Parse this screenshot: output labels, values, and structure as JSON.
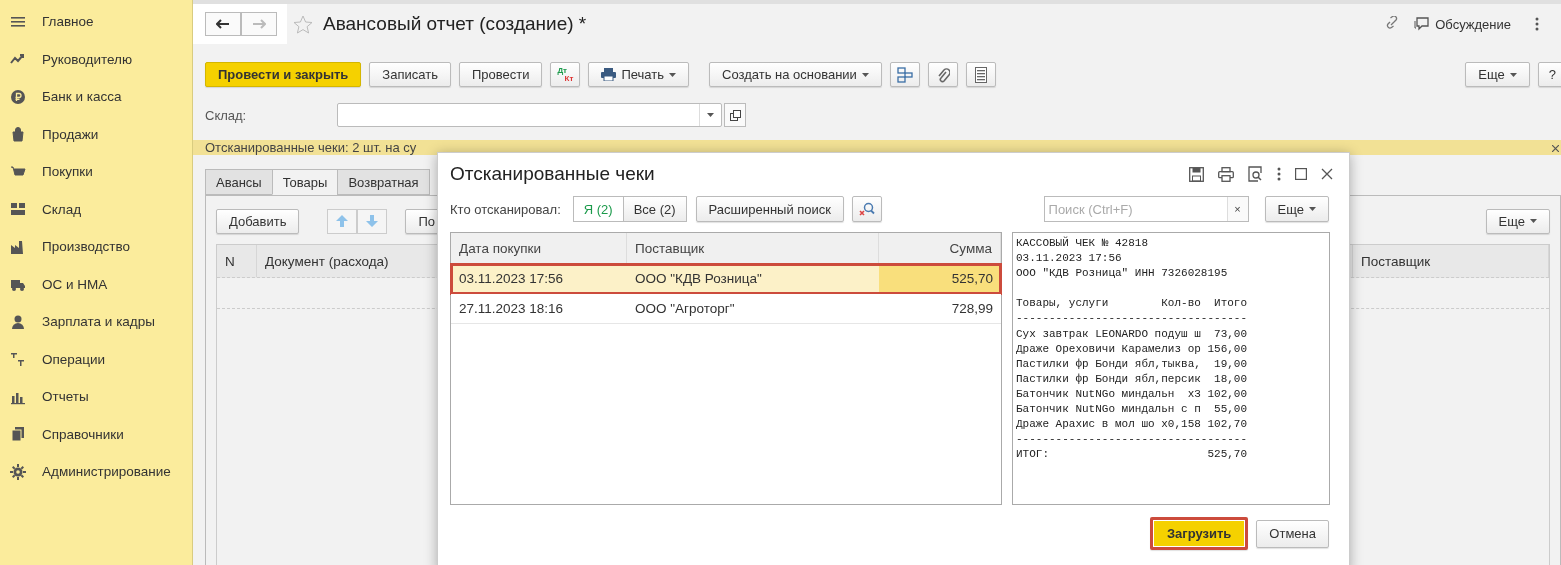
{
  "sidebar": {
    "items": [
      {
        "label": "Главное",
        "selected": false
      },
      {
        "label": "Руководителю",
        "selected": false
      },
      {
        "label": "Банк и касса",
        "selected": false
      },
      {
        "label": "Продажи",
        "selected": false
      },
      {
        "label": "Покупки",
        "selected": false
      },
      {
        "label": "Склад",
        "selected": false
      },
      {
        "label": "Производство",
        "selected": false
      },
      {
        "label": "ОС и НМА",
        "selected": false
      },
      {
        "label": "Зарплата и кадры",
        "selected": false
      },
      {
        "label": "Операции",
        "selected": false
      },
      {
        "label": "Отчеты",
        "selected": false
      },
      {
        "label": "Справочники",
        "selected": false
      },
      {
        "label": "Администрирование",
        "selected": false
      }
    ]
  },
  "document": {
    "title": "Авансовый отчет (создание) *",
    "discussion": "Обсуждение",
    "toolbar": [
      {
        "kind": "primary",
        "label": "Провести и закрыть"
      },
      {
        "kind": "text",
        "label": "Записать"
      },
      {
        "kind": "text",
        "label": "Провести"
      },
      {
        "kind": "dtkt",
        "debit": "Дт",
        "credit": "Кт"
      },
      {
        "kind": "print",
        "label": "Печать"
      },
      {
        "kind": "menu",
        "label": "Создать на основании"
      },
      {
        "kind": "structure"
      },
      {
        "kind": "clip"
      },
      {
        "kind": "list"
      }
    ],
    "more": "Еще",
    "help": "?",
    "warehouse": {
      "label": "Склад:"
    },
    "banner": "Отсканированные чеки: 2 шт. на су",
    "tabs": [
      {
        "label": "Авансы",
        "selected": false
      },
      {
        "label": "Товары",
        "selected": true
      },
      {
        "label": "Возвратная",
        "selected": false
      }
    ],
    "table_toolbar": {
      "add": "Добавить",
      "cut_button": "По",
      "more": "Еще"
    },
    "table": {
      "columns": [
        "N",
        "Документ (расхода)",
        "Поставщик"
      ]
    }
  },
  "dialog": {
    "title": "Отсканированные чеки",
    "filter_label": "Кто отсканировал:",
    "filters": [
      {
        "label": "Я (2)",
        "selected": true
      },
      {
        "label": "Все (2)",
        "selected": false
      }
    ],
    "advanced_search": "Расширенный поиск",
    "search": {
      "placeholder": "Поиск (Ctrl+F)",
      "clear": "×"
    },
    "more": "Еще",
    "columns": [
      "Дата покупки",
      "Поставщик",
      "Сумма"
    ],
    "rows": [
      {
        "date": "03.11.2023 17:56",
        "supplier": "ООО \"КДВ Розница\"",
        "sum": "525,70",
        "selected": true
      },
      {
        "date": "27.11.2023 18:16",
        "supplier": "ООО \"Агроторг\"",
        "sum": "728,99",
        "selected": false
      }
    ],
    "receipt": [
      "КАССОВЫЙ ЧЕК № 42818",
      "03.11.2023 17:56",
      "ООО \"КДВ Розница\" ИНН 7326028195"
    ],
    "receipt_body": [
      "Товары, услуги        Кол-во  Итого",
      "-----------------------------------",
      "Сух завтрак LEONARDO подуш ш  73,00",
      "Драже Ореховичи Карамелиз ор 156,00",
      "Пастилки фр Бонди ябл,тыква,  19,00",
      "Пастилки фр Бонди ябл,персик  18,00",
      "Батончик NutNGo миндальн  x3 102,00",
      "Батончик NutNGo миндальн с п  55,00",
      "Драже Арахис в мол шо x0,158 102,70",
      "-----------------------------------",
      "ИТОГ:                        525,70"
    ],
    "load": "Загрузить",
    "cancel": "Отмена"
  }
}
